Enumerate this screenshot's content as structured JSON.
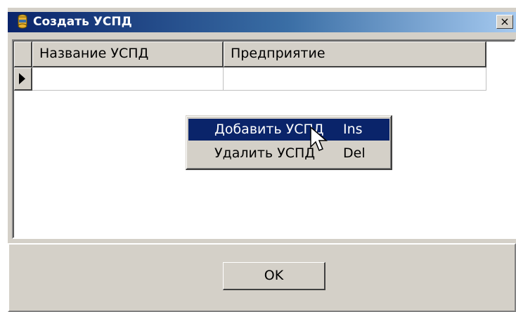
{
  "window": {
    "title": "Создать УСПД",
    "close_label": "×"
  },
  "grid": {
    "columns": [
      "Название УСПД",
      "Предприятие"
    ],
    "rows": [
      [
        "",
        ""
      ]
    ]
  },
  "context_menu": {
    "items": [
      {
        "label": "Добавить УСПД",
        "shortcut": "Ins",
        "selected": true
      },
      {
        "label": "Удалить УСПД",
        "shortcut": "Del",
        "selected": false
      }
    ]
  },
  "footer": {
    "ok_label": "OK"
  },
  "icons": {
    "title_icon": "database-icon",
    "row_indicator": "row-pointer-icon",
    "cursor": "mouse-pointer-icon"
  },
  "colors": {
    "titlebar_start": "#0a246a",
    "titlebar_end": "#a6caf0",
    "face": "#d4d0c8",
    "selection": "#0a246a"
  }
}
